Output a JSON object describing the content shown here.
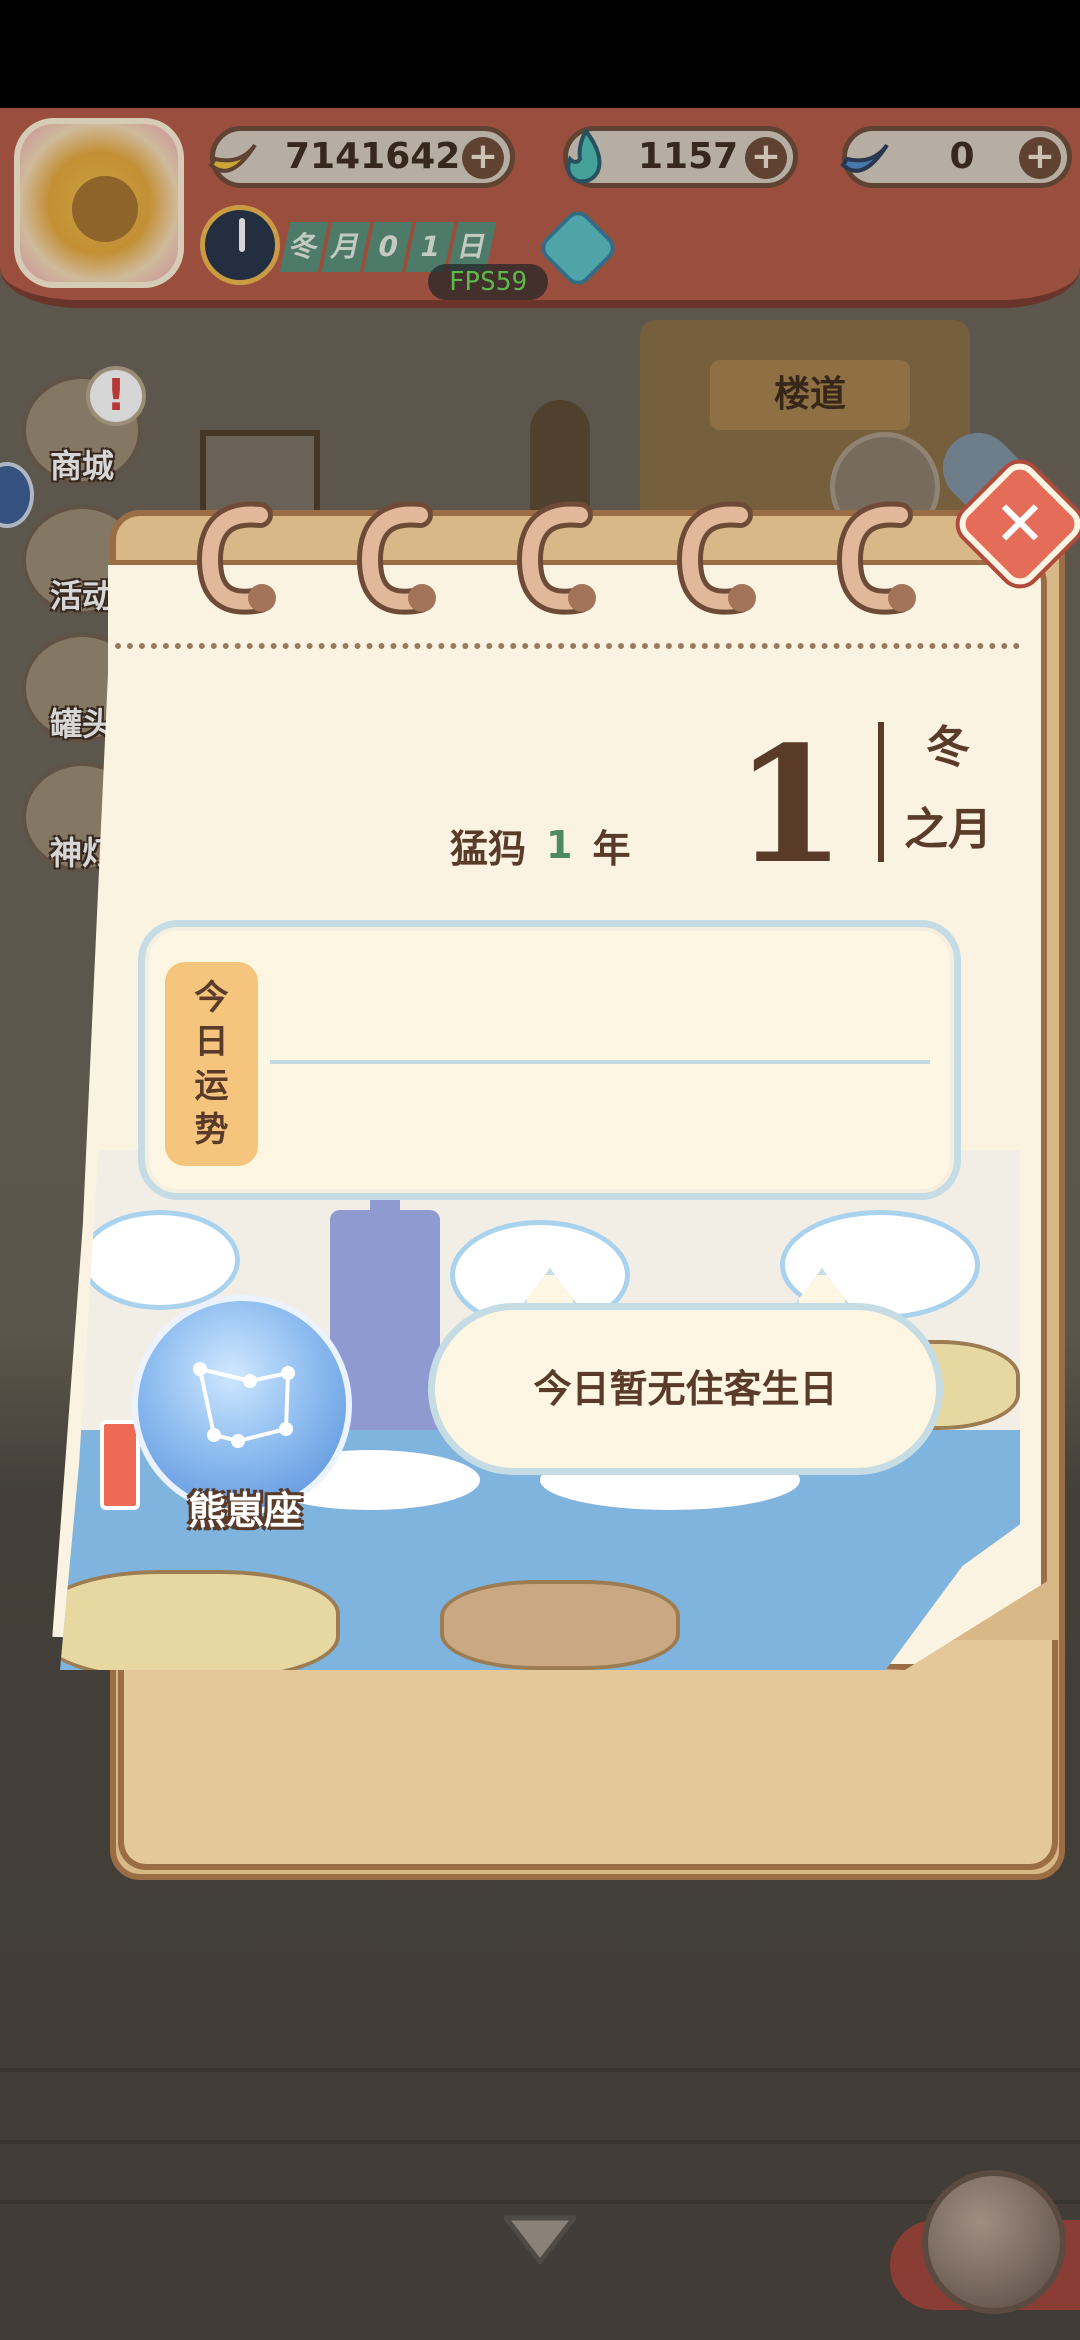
{
  "hud": {
    "currencies": [
      {
        "name": "banana",
        "value": "7141642"
      },
      {
        "name": "flame",
        "value": "1157"
      },
      {
        "name": "blue-banana",
        "value": "0"
      }
    ],
    "date_chars": [
      "冬",
      "月",
      "0",
      "1",
      "日"
    ],
    "fps": "FPS59"
  },
  "room": {
    "hall_sign": "楼道"
  },
  "side_menu": [
    {
      "label": "商城",
      "icon": "shop-icon"
    },
    {
      "label": "活动",
      "icon": "gift-icon"
    },
    {
      "label": "罐头",
      "icon": "can-icon"
    },
    {
      "label": "神灯",
      "icon": "lamp-icon"
    }
  ],
  "calendar": {
    "year_prefix": "猛犸",
    "year_number": "1",
    "year_suffix": "年",
    "day": "1",
    "season": "冬",
    "month_label": "之月",
    "fortune_title": [
      "今",
      "日",
      "运",
      "势"
    ],
    "fortune_text": "",
    "constellation": "熊崽座",
    "birthday_text": "今日暂无住客生日",
    "close_symbol": "✕"
  },
  "colors": {
    "brown_text": "#5a3b2a",
    "year_green": "#4e8a63",
    "close_red": "#e56c58",
    "banner_red": "#b65a45",
    "fps_green": "#6cdc5a"
  }
}
